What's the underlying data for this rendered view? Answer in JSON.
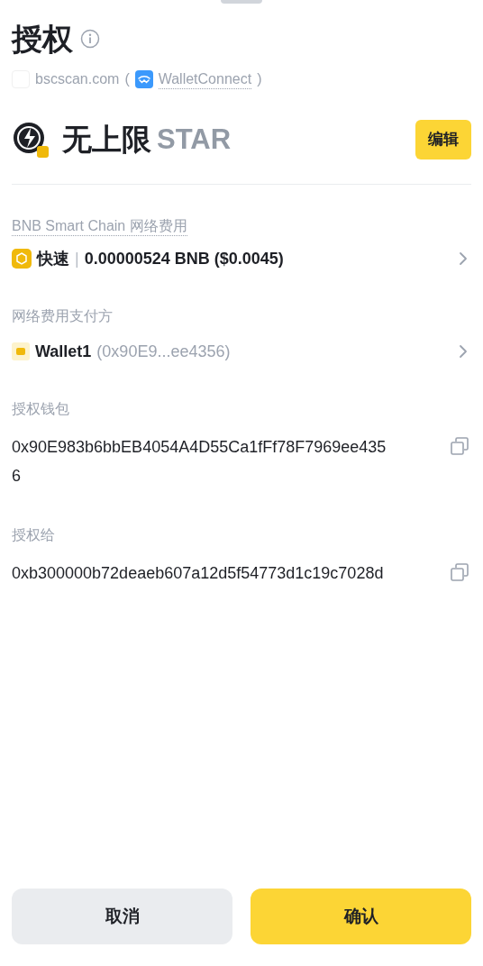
{
  "title": "授权",
  "source": {
    "site": "bscscan.com",
    "open_paren": "(",
    "connector": "WalletConnect",
    "close_paren": ")"
  },
  "token": {
    "amount": "无上限",
    "symbol": "STAR",
    "edit_button": "编辑"
  },
  "fee": {
    "label": "BNB Smart Chain 网络费用",
    "speed": "快速",
    "separator": "|",
    "value": "0.00000524 BNB ($0.0045)"
  },
  "payer": {
    "label": "网络费用支付方",
    "wallet": "Wallet1",
    "address": "(0x90E9...ee4356)"
  },
  "addresses": [
    {
      "label": "授权钱包",
      "value": "0x90E983b6bbEB4054A4D55Ca1fFf78F7969ee4356"
    },
    {
      "label": "授权给",
      "value": "0xb300000b72deaeb607a12d5f54773d1c19c7028d"
    }
  ],
  "buttons": [
    {
      "label": "取消",
      "kind": "secondary"
    },
    {
      "label": "确认",
      "kind": "primary"
    }
  ]
}
